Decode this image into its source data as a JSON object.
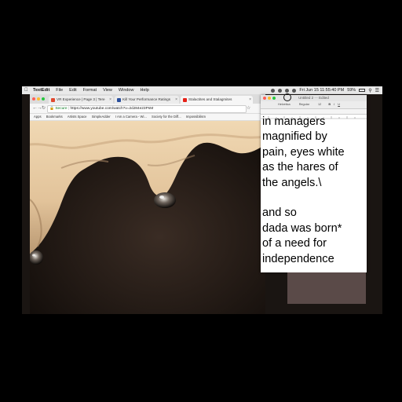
{
  "menubar": {
    "app_name": "TextEdit",
    "items": [
      "File",
      "Edit",
      "Format",
      "View",
      "Window",
      "Help"
    ],
    "clock": "Fri Jun 15  11:55:40 PM",
    "battery": "59%"
  },
  "browser": {
    "tabs": [
      {
        "label": "VR Experience | Page 3 | Tere",
        "favicon_color": "#e0492f"
      },
      {
        "label": "Kill Your Performance Ratings",
        "favicon_color": "#2a4f9c"
      },
      {
        "label": "Stalactites and Stalagmites",
        "favicon_color": "#e62117"
      }
    ],
    "secure_label": "Secure",
    "url": "https://www.youtube.com/watch?v=2dJ84e23PsM",
    "bookmarks": [
      "Apps",
      "Bookmarks",
      "Artists Space",
      "SimpleAdder",
      "I Am a Camera - Wi...",
      "Society for the Diff...",
      "Impossibilism"
    ]
  },
  "textedit": {
    "title": "Untitled 2",
    "status": "Edited",
    "toolbar": [
      "Helvetica",
      "Regular",
      "12"
    ],
    "text": "in managers\nmagnified by\npain, eyes white\nas the hares of\nthe angels.\\\n\nand so\ndada was born*\nof a need for\nindependence"
  },
  "colors": {
    "rock": "#e5cba5",
    "rock_shadow": "#b99872",
    "background": "#1b1410",
    "accent_green": "#0a7a23"
  }
}
